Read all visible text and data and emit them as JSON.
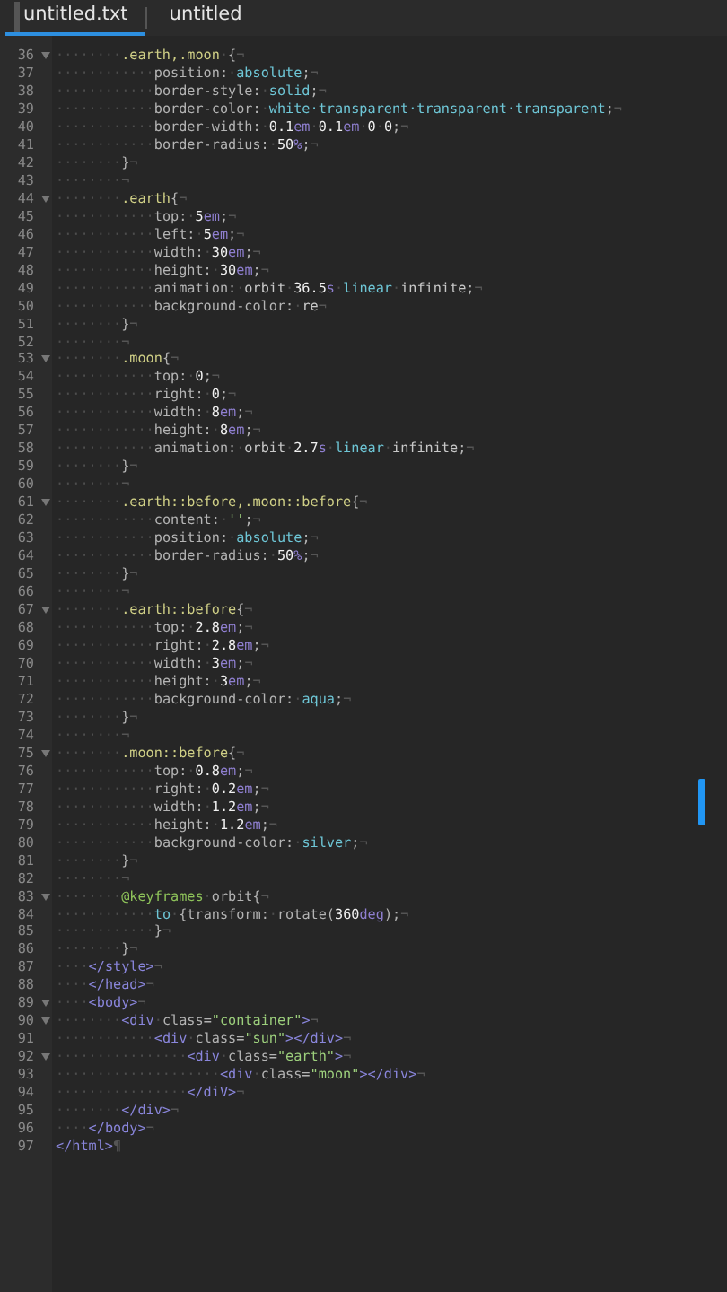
{
  "tabs": [
    {
      "label": "untitled.txt",
      "selected": true
    },
    {
      "label": "untitled",
      "selected": false
    }
  ],
  "lines": [
    {
      "number": "36",
      "foldable": true,
      "tokens": [
        {
          "kind": "ws",
          "text": "········"
        },
        {
          "kind": "selector",
          "text": ".earth,.moon"
        },
        {
          "kind": "ws",
          "text": "·"
        },
        {
          "kind": "punct",
          "text": "{"
        },
        {
          "kind": "eol",
          "text": "¬"
        }
      ]
    },
    {
      "number": "37",
      "foldable": false,
      "tokens": [
        {
          "kind": "ws",
          "text": "············"
        },
        {
          "kind": "prop",
          "text": "position:"
        },
        {
          "kind": "ws",
          "text": "·"
        },
        {
          "kind": "value",
          "text": "absolute"
        },
        {
          "kind": "punct",
          "text": ";"
        },
        {
          "kind": "eol",
          "text": "¬"
        }
      ]
    },
    {
      "number": "38",
      "foldable": false,
      "tokens": [
        {
          "kind": "ws",
          "text": "············"
        },
        {
          "kind": "prop",
          "text": "border-style:"
        },
        {
          "kind": "ws",
          "text": "·"
        },
        {
          "kind": "value",
          "text": "solid"
        },
        {
          "kind": "punct",
          "text": ";"
        },
        {
          "kind": "eol",
          "text": "¬"
        }
      ]
    },
    {
      "number": "39",
      "foldable": false,
      "tokens": [
        {
          "kind": "ws",
          "text": "············"
        },
        {
          "kind": "prop",
          "text": "border-color:"
        },
        {
          "kind": "ws",
          "text": "·"
        },
        {
          "kind": "value",
          "text": "white·transparent·transparent·transparent"
        },
        {
          "kind": "punct",
          "text": ";"
        },
        {
          "kind": "eol",
          "text": "¬"
        }
      ]
    },
    {
      "number": "40",
      "foldable": false,
      "tokens": [
        {
          "kind": "ws",
          "text": "············"
        },
        {
          "kind": "prop",
          "text": "border-width:"
        },
        {
          "kind": "ws",
          "text": "·"
        },
        {
          "kind": "num",
          "text": "0.1"
        },
        {
          "kind": "unit",
          "text": "em"
        },
        {
          "kind": "ws",
          "text": "·"
        },
        {
          "kind": "num",
          "text": "0.1"
        },
        {
          "kind": "unit",
          "text": "em"
        },
        {
          "kind": "ws",
          "text": "·"
        },
        {
          "kind": "num",
          "text": "0"
        },
        {
          "kind": "ws",
          "text": "·"
        },
        {
          "kind": "num",
          "text": "0"
        },
        {
          "kind": "punct",
          "text": ";"
        },
        {
          "kind": "eol",
          "text": "¬"
        }
      ]
    },
    {
      "number": "41",
      "foldable": false,
      "tokens": [
        {
          "kind": "ws",
          "text": "············"
        },
        {
          "kind": "prop",
          "text": "border-radius:"
        },
        {
          "kind": "ws",
          "text": "·"
        },
        {
          "kind": "num",
          "text": "50"
        },
        {
          "kind": "unit",
          "text": "%"
        },
        {
          "kind": "punct",
          "text": ";"
        },
        {
          "kind": "eol",
          "text": "¬"
        }
      ]
    },
    {
      "number": "42",
      "foldable": false,
      "tokens": [
        {
          "kind": "ws",
          "text": "········"
        },
        {
          "kind": "punct",
          "text": "}"
        },
        {
          "kind": "eol",
          "text": "¬"
        }
      ]
    },
    {
      "number": "43",
      "foldable": false,
      "tokens": [
        {
          "kind": "ws",
          "text": "········"
        },
        {
          "kind": "eol",
          "text": "¬"
        }
      ]
    },
    {
      "number": "44",
      "foldable": true,
      "tokens": [
        {
          "kind": "ws",
          "text": "········"
        },
        {
          "kind": "selector",
          "text": ".earth"
        },
        {
          "kind": "punct",
          "text": "{"
        },
        {
          "kind": "eol",
          "text": "¬"
        }
      ]
    },
    {
      "number": "45",
      "foldable": false,
      "tokens": [
        {
          "kind": "ws",
          "text": "············"
        },
        {
          "kind": "prop",
          "text": "top:"
        },
        {
          "kind": "ws",
          "text": "·"
        },
        {
          "kind": "num",
          "text": "5"
        },
        {
          "kind": "unit",
          "text": "em"
        },
        {
          "kind": "punct",
          "text": ";"
        },
        {
          "kind": "eol",
          "text": "¬"
        }
      ]
    },
    {
      "number": "46",
      "foldable": false,
      "tokens": [
        {
          "kind": "ws",
          "text": "············"
        },
        {
          "kind": "prop",
          "text": "left:"
        },
        {
          "kind": "ws",
          "text": "·"
        },
        {
          "kind": "num",
          "text": "5"
        },
        {
          "kind": "unit",
          "text": "em"
        },
        {
          "kind": "punct",
          "text": ";"
        },
        {
          "kind": "eol",
          "text": "¬"
        }
      ]
    },
    {
      "number": "47",
      "foldable": false,
      "tokens": [
        {
          "kind": "ws",
          "text": "············"
        },
        {
          "kind": "prop",
          "text": "width:"
        },
        {
          "kind": "ws",
          "text": "·"
        },
        {
          "kind": "num",
          "text": "30"
        },
        {
          "kind": "unit",
          "text": "em"
        },
        {
          "kind": "punct",
          "text": ";"
        },
        {
          "kind": "eol",
          "text": "¬"
        }
      ]
    },
    {
      "number": "48",
      "foldable": false,
      "tokens": [
        {
          "kind": "ws",
          "text": "············"
        },
        {
          "kind": "prop",
          "text": "height:"
        },
        {
          "kind": "ws",
          "text": "·"
        },
        {
          "kind": "num",
          "text": "30"
        },
        {
          "kind": "unit",
          "text": "em"
        },
        {
          "kind": "punct",
          "text": ";"
        },
        {
          "kind": "eol",
          "text": "¬"
        }
      ]
    },
    {
      "number": "49",
      "foldable": false,
      "tokens": [
        {
          "kind": "ws",
          "text": "············"
        },
        {
          "kind": "prop",
          "text": "animation:"
        },
        {
          "kind": "ws",
          "text": "·"
        },
        {
          "kind": "plain",
          "text": "orbit"
        },
        {
          "kind": "ws",
          "text": "·"
        },
        {
          "kind": "num",
          "text": "36.5"
        },
        {
          "kind": "unit",
          "text": "s"
        },
        {
          "kind": "ws",
          "text": "·"
        },
        {
          "kind": "value",
          "text": "linear"
        },
        {
          "kind": "ws",
          "text": "·"
        },
        {
          "kind": "plain",
          "text": "infinite"
        },
        {
          "kind": "punct",
          "text": ";"
        },
        {
          "kind": "eol",
          "text": "¬"
        }
      ]
    },
    {
      "number": "50",
      "foldable": false,
      "tokens": [
        {
          "kind": "ws",
          "text": "············"
        },
        {
          "kind": "prop",
          "text": "background-color:"
        },
        {
          "kind": "ws",
          "text": "·"
        },
        {
          "kind": "plain",
          "text": "re"
        },
        {
          "kind": "eol",
          "text": "¬"
        }
      ]
    },
    {
      "number": "51",
      "foldable": false,
      "tokens": [
        {
          "kind": "ws",
          "text": "········"
        },
        {
          "kind": "punct",
          "text": "}"
        },
        {
          "kind": "eol",
          "text": "¬"
        }
      ]
    },
    {
      "number": "52",
      "foldable": false,
      "tokens": [
        {
          "kind": "ws",
          "text": "········"
        },
        {
          "kind": "eol",
          "text": "¬"
        }
      ]
    },
    {
      "number": "53",
      "foldable": true,
      "tokens": [
        {
          "kind": "ws",
          "text": "········"
        },
        {
          "kind": "selector",
          "text": ".moon"
        },
        {
          "kind": "punct",
          "text": "{"
        },
        {
          "kind": "eol",
          "text": "¬"
        }
      ]
    },
    {
      "number": "54",
      "foldable": false,
      "tokens": [
        {
          "kind": "ws",
          "text": "············"
        },
        {
          "kind": "prop",
          "text": "top:"
        },
        {
          "kind": "ws",
          "text": "·"
        },
        {
          "kind": "num",
          "text": "0"
        },
        {
          "kind": "punct",
          "text": ";"
        },
        {
          "kind": "eol",
          "text": "¬"
        }
      ]
    },
    {
      "number": "55",
      "foldable": false,
      "tokens": [
        {
          "kind": "ws",
          "text": "············"
        },
        {
          "kind": "prop",
          "text": "right:"
        },
        {
          "kind": "ws",
          "text": "·"
        },
        {
          "kind": "num",
          "text": "0"
        },
        {
          "kind": "punct",
          "text": ";"
        },
        {
          "kind": "eol",
          "text": "¬"
        }
      ]
    },
    {
      "number": "56",
      "foldable": false,
      "tokens": [
        {
          "kind": "ws",
          "text": "············"
        },
        {
          "kind": "prop",
          "text": "width:"
        },
        {
          "kind": "ws",
          "text": "·"
        },
        {
          "kind": "num",
          "text": "8"
        },
        {
          "kind": "unit",
          "text": "em"
        },
        {
          "kind": "punct",
          "text": ";"
        },
        {
          "kind": "eol",
          "text": "¬"
        }
      ]
    },
    {
      "number": "57",
      "foldable": false,
      "tokens": [
        {
          "kind": "ws",
          "text": "············"
        },
        {
          "kind": "prop",
          "text": "height:"
        },
        {
          "kind": "ws",
          "text": "·"
        },
        {
          "kind": "num",
          "text": "8"
        },
        {
          "kind": "unit",
          "text": "em"
        },
        {
          "kind": "punct",
          "text": ";"
        },
        {
          "kind": "eol",
          "text": "¬"
        }
      ]
    },
    {
      "number": "58",
      "foldable": false,
      "tokens": [
        {
          "kind": "ws",
          "text": "············"
        },
        {
          "kind": "prop",
          "text": "animation:"
        },
        {
          "kind": "ws",
          "text": "·"
        },
        {
          "kind": "plain",
          "text": "orbit"
        },
        {
          "kind": "ws",
          "text": "·"
        },
        {
          "kind": "num",
          "text": "2.7"
        },
        {
          "kind": "unit",
          "text": "s"
        },
        {
          "kind": "ws",
          "text": "·"
        },
        {
          "kind": "value",
          "text": "linear"
        },
        {
          "kind": "ws",
          "text": "·"
        },
        {
          "kind": "plain",
          "text": "infinite"
        },
        {
          "kind": "punct",
          "text": ";"
        },
        {
          "kind": "eol",
          "text": "¬"
        }
      ]
    },
    {
      "number": "59",
      "foldable": false,
      "tokens": [
        {
          "kind": "ws",
          "text": "········"
        },
        {
          "kind": "punct",
          "text": "}"
        },
        {
          "kind": "eol",
          "text": "¬"
        }
      ]
    },
    {
      "number": "60",
      "foldable": false,
      "tokens": [
        {
          "kind": "ws",
          "text": "········"
        },
        {
          "kind": "eol",
          "text": "¬"
        }
      ]
    },
    {
      "number": "61",
      "foldable": true,
      "tokens": [
        {
          "kind": "ws",
          "text": "········"
        },
        {
          "kind": "selector",
          "text": ".earth::before,.moon::before"
        },
        {
          "kind": "punct",
          "text": "{"
        },
        {
          "kind": "eol",
          "text": "¬"
        }
      ]
    },
    {
      "number": "62",
      "foldable": false,
      "tokens": [
        {
          "kind": "ws",
          "text": "············"
        },
        {
          "kind": "prop",
          "text": "content:"
        },
        {
          "kind": "ws",
          "text": "·"
        },
        {
          "kind": "string",
          "text": "''"
        },
        {
          "kind": "punct",
          "text": ";"
        },
        {
          "kind": "eol",
          "text": "¬"
        }
      ]
    },
    {
      "number": "63",
      "foldable": false,
      "tokens": [
        {
          "kind": "ws",
          "text": "············"
        },
        {
          "kind": "prop",
          "text": "position:"
        },
        {
          "kind": "ws",
          "text": "·"
        },
        {
          "kind": "value",
          "text": "absolute"
        },
        {
          "kind": "punct",
          "text": ";"
        },
        {
          "kind": "eol",
          "text": "¬"
        }
      ]
    },
    {
      "number": "64",
      "foldable": false,
      "tokens": [
        {
          "kind": "ws",
          "text": "············"
        },
        {
          "kind": "prop",
          "text": "border-radius:"
        },
        {
          "kind": "ws",
          "text": "·"
        },
        {
          "kind": "num",
          "text": "50"
        },
        {
          "kind": "unit",
          "text": "%"
        },
        {
          "kind": "punct",
          "text": ";"
        },
        {
          "kind": "eol",
          "text": "¬"
        }
      ]
    },
    {
      "number": "65",
      "foldable": false,
      "tokens": [
        {
          "kind": "ws",
          "text": "········"
        },
        {
          "kind": "punct",
          "text": "}"
        },
        {
          "kind": "eol",
          "text": "¬"
        }
      ]
    },
    {
      "number": "66",
      "foldable": false,
      "tokens": [
        {
          "kind": "ws",
          "text": "········"
        },
        {
          "kind": "eol",
          "text": "¬"
        }
      ]
    },
    {
      "number": "67",
      "foldable": true,
      "tokens": [
        {
          "kind": "ws",
          "text": "········"
        },
        {
          "kind": "selector",
          "text": ".earth::before"
        },
        {
          "kind": "punct",
          "text": "{"
        },
        {
          "kind": "eol",
          "text": "¬"
        }
      ]
    },
    {
      "number": "68",
      "foldable": false,
      "tokens": [
        {
          "kind": "ws",
          "text": "············"
        },
        {
          "kind": "prop",
          "text": "top:"
        },
        {
          "kind": "ws",
          "text": "·"
        },
        {
          "kind": "num",
          "text": "2.8"
        },
        {
          "kind": "unit",
          "text": "em"
        },
        {
          "kind": "punct",
          "text": ";"
        },
        {
          "kind": "eol",
          "text": "¬"
        }
      ]
    },
    {
      "number": "69",
      "foldable": false,
      "tokens": [
        {
          "kind": "ws",
          "text": "············"
        },
        {
          "kind": "prop",
          "text": "right:"
        },
        {
          "kind": "ws",
          "text": "·"
        },
        {
          "kind": "num",
          "text": "2.8"
        },
        {
          "kind": "unit",
          "text": "em"
        },
        {
          "kind": "punct",
          "text": ";"
        },
        {
          "kind": "eol",
          "text": "¬"
        }
      ]
    },
    {
      "number": "70",
      "foldable": false,
      "tokens": [
        {
          "kind": "ws",
          "text": "············"
        },
        {
          "kind": "prop",
          "text": "width:"
        },
        {
          "kind": "ws",
          "text": "·"
        },
        {
          "kind": "num",
          "text": "3"
        },
        {
          "kind": "unit",
          "text": "em"
        },
        {
          "kind": "punct",
          "text": ";"
        },
        {
          "kind": "eol",
          "text": "¬"
        }
      ]
    },
    {
      "number": "71",
      "foldable": false,
      "tokens": [
        {
          "kind": "ws",
          "text": "············"
        },
        {
          "kind": "prop",
          "text": "height:"
        },
        {
          "kind": "ws",
          "text": "·"
        },
        {
          "kind": "num",
          "text": "3"
        },
        {
          "kind": "unit",
          "text": "em"
        },
        {
          "kind": "punct",
          "text": ";"
        },
        {
          "kind": "eol",
          "text": "¬"
        }
      ]
    },
    {
      "number": "72",
      "foldable": false,
      "tokens": [
        {
          "kind": "ws",
          "text": "············"
        },
        {
          "kind": "prop",
          "text": "background-color:"
        },
        {
          "kind": "ws",
          "text": "·"
        },
        {
          "kind": "value",
          "text": "aqua"
        },
        {
          "kind": "punct",
          "text": ";"
        },
        {
          "kind": "eol",
          "text": "¬"
        }
      ]
    },
    {
      "number": "73",
      "foldable": false,
      "tokens": [
        {
          "kind": "ws",
          "text": "········"
        },
        {
          "kind": "punct",
          "text": "}"
        },
        {
          "kind": "eol",
          "text": "¬"
        }
      ]
    },
    {
      "number": "74",
      "foldable": false,
      "tokens": [
        {
          "kind": "ws",
          "text": "········"
        },
        {
          "kind": "eol",
          "text": "¬"
        }
      ]
    },
    {
      "number": "75",
      "foldable": true,
      "tokens": [
        {
          "kind": "ws",
          "text": "········"
        },
        {
          "kind": "selector",
          "text": ".moon::before"
        },
        {
          "kind": "punct",
          "text": "{"
        },
        {
          "kind": "eol",
          "text": "¬"
        }
      ]
    },
    {
      "number": "76",
      "foldable": false,
      "tokens": [
        {
          "kind": "ws",
          "text": "············"
        },
        {
          "kind": "prop",
          "text": "top:"
        },
        {
          "kind": "ws",
          "text": "·"
        },
        {
          "kind": "num",
          "text": "0.8"
        },
        {
          "kind": "unit",
          "text": "em"
        },
        {
          "kind": "punct",
          "text": ";"
        },
        {
          "kind": "eol",
          "text": "¬"
        }
      ]
    },
    {
      "number": "77",
      "foldable": false,
      "tokens": [
        {
          "kind": "ws",
          "text": "············"
        },
        {
          "kind": "prop",
          "text": "right:"
        },
        {
          "kind": "ws",
          "text": "·"
        },
        {
          "kind": "num",
          "text": "0.2"
        },
        {
          "kind": "unit",
          "text": "em"
        },
        {
          "kind": "punct",
          "text": ";"
        },
        {
          "kind": "eol",
          "text": "¬"
        }
      ]
    },
    {
      "number": "78",
      "foldable": false,
      "tokens": [
        {
          "kind": "ws",
          "text": "············"
        },
        {
          "kind": "prop",
          "text": "width:"
        },
        {
          "kind": "ws",
          "text": "·"
        },
        {
          "kind": "num",
          "text": "1.2"
        },
        {
          "kind": "unit",
          "text": "em"
        },
        {
          "kind": "punct",
          "text": ";"
        },
        {
          "kind": "eol",
          "text": "¬"
        }
      ]
    },
    {
      "number": "79",
      "foldable": false,
      "tokens": [
        {
          "kind": "ws",
          "text": "············"
        },
        {
          "kind": "prop",
          "text": "height:"
        },
        {
          "kind": "ws",
          "text": "·"
        },
        {
          "kind": "num",
          "text": "1.2"
        },
        {
          "kind": "unit",
          "text": "em"
        },
        {
          "kind": "punct",
          "text": ";"
        },
        {
          "kind": "eol",
          "text": "¬"
        }
      ]
    },
    {
      "number": "80",
      "foldable": false,
      "tokens": [
        {
          "kind": "ws",
          "text": "············"
        },
        {
          "kind": "prop",
          "text": "background-color:"
        },
        {
          "kind": "ws",
          "text": "·"
        },
        {
          "kind": "value",
          "text": "silver"
        },
        {
          "kind": "punct",
          "text": ";"
        },
        {
          "kind": "eol",
          "text": "¬"
        }
      ]
    },
    {
      "number": "81",
      "foldable": false,
      "tokens": [
        {
          "kind": "ws",
          "text": "········"
        },
        {
          "kind": "punct",
          "text": "}"
        },
        {
          "kind": "eol",
          "text": "¬"
        }
      ]
    },
    {
      "number": "82",
      "foldable": false,
      "tokens": [
        {
          "kind": "ws",
          "text": "········"
        },
        {
          "kind": "eol",
          "text": "¬"
        }
      ]
    },
    {
      "number": "83",
      "foldable": true,
      "tokens": [
        {
          "kind": "ws",
          "text": "········"
        },
        {
          "kind": "keyword",
          "text": "@keyframes"
        },
        {
          "kind": "ws",
          "text": "·"
        },
        {
          "kind": "prop",
          "text": "orbit"
        },
        {
          "kind": "punct",
          "text": "{"
        },
        {
          "kind": "eol",
          "text": "¬"
        }
      ]
    },
    {
      "number": "84",
      "foldable": false,
      "tokens": [
        {
          "kind": "ws",
          "text": "············"
        },
        {
          "kind": "value",
          "text": "to"
        },
        {
          "kind": "ws",
          "text": "·"
        },
        {
          "kind": "prop",
          "text": "{transform:"
        },
        {
          "kind": "ws",
          "text": "·"
        },
        {
          "kind": "prop",
          "text": "rotate("
        },
        {
          "kind": "num",
          "text": "360"
        },
        {
          "kind": "unit",
          "text": "deg"
        },
        {
          "kind": "punct",
          "text": ");"
        },
        {
          "kind": "eol",
          "text": "¬"
        }
      ]
    },
    {
      "number": "85",
      "foldable": false,
      "tokens": [
        {
          "kind": "ws",
          "text": "············"
        },
        {
          "kind": "punct",
          "text": "}"
        },
        {
          "kind": "eol",
          "text": "¬"
        }
      ]
    },
    {
      "number": "86",
      "foldable": false,
      "tokens": [
        {
          "kind": "ws",
          "text": "········"
        },
        {
          "kind": "punct",
          "text": "}"
        },
        {
          "kind": "eol",
          "text": "¬"
        }
      ]
    },
    {
      "number": "87",
      "foldable": false,
      "tokens": [
        {
          "kind": "ws",
          "text": "····"
        },
        {
          "kind": "tag",
          "text": "</style>"
        },
        {
          "kind": "eol",
          "text": "¬"
        }
      ]
    },
    {
      "number": "88",
      "foldable": false,
      "tokens": [
        {
          "kind": "ws",
          "text": "····"
        },
        {
          "kind": "tag",
          "text": "</head>"
        },
        {
          "kind": "eol",
          "text": "¬"
        }
      ]
    },
    {
      "number": "89",
      "foldable": true,
      "tokens": [
        {
          "kind": "ws",
          "text": "····"
        },
        {
          "kind": "tag",
          "text": "<body>"
        },
        {
          "kind": "eol",
          "text": "¬"
        }
      ]
    },
    {
      "number": "90",
      "foldable": true,
      "tokens": [
        {
          "kind": "ws",
          "text": "········"
        },
        {
          "kind": "tag",
          "text": "<div"
        },
        {
          "kind": "ws",
          "text": "·"
        },
        {
          "kind": "prop",
          "text": "class"
        },
        {
          "kind": "punct",
          "text": "="
        },
        {
          "kind": "string",
          "text": "\"container\""
        },
        {
          "kind": "tag",
          "text": ">"
        },
        {
          "kind": "eol",
          "text": "¬"
        }
      ]
    },
    {
      "number": "91",
      "foldable": false,
      "tokens": [
        {
          "kind": "ws",
          "text": "············"
        },
        {
          "kind": "tag",
          "text": "<div"
        },
        {
          "kind": "ws",
          "text": "·"
        },
        {
          "kind": "prop",
          "text": "class"
        },
        {
          "kind": "punct",
          "text": "="
        },
        {
          "kind": "string",
          "text": "\"sun\""
        },
        {
          "kind": "tag",
          "text": "></div>"
        },
        {
          "kind": "eol",
          "text": "¬"
        }
      ]
    },
    {
      "number": "92",
      "foldable": true,
      "tokens": [
        {
          "kind": "ws",
          "text": "················"
        },
        {
          "kind": "tag",
          "text": "<div"
        },
        {
          "kind": "ws",
          "text": "·"
        },
        {
          "kind": "prop",
          "text": "class"
        },
        {
          "kind": "punct",
          "text": "="
        },
        {
          "kind": "string",
          "text": "\"earth\""
        },
        {
          "kind": "tag",
          "text": ">"
        },
        {
          "kind": "eol",
          "text": "¬"
        }
      ]
    },
    {
      "number": "93",
      "foldable": false,
      "tokens": [
        {
          "kind": "ws",
          "text": "····················"
        },
        {
          "kind": "tag",
          "text": "<div"
        },
        {
          "kind": "ws",
          "text": "·"
        },
        {
          "kind": "prop",
          "text": "class"
        },
        {
          "kind": "punct",
          "text": "="
        },
        {
          "kind": "string",
          "text": "\"moon\""
        },
        {
          "kind": "tag",
          "text": "></div>"
        },
        {
          "kind": "eol",
          "text": "¬"
        }
      ]
    },
    {
      "number": "94",
      "foldable": false,
      "tokens": [
        {
          "kind": "ws",
          "text": "················"
        },
        {
          "kind": "tag",
          "text": "</diV>"
        },
        {
          "kind": "eol",
          "text": "¬"
        }
      ]
    },
    {
      "number": "95",
      "foldable": false,
      "tokens": [
        {
          "kind": "ws",
          "text": "········"
        },
        {
          "kind": "tag",
          "text": "</div>"
        },
        {
          "kind": "eol",
          "text": "¬"
        }
      ]
    },
    {
      "number": "96",
      "foldable": false,
      "tokens": [
        {
          "kind": "ws",
          "text": "····"
        },
        {
          "kind": "tag",
          "text": "</body>"
        },
        {
          "kind": "eol",
          "text": "¬"
        }
      ]
    },
    {
      "number": "97",
      "foldable": false,
      "tokens": [
        {
          "kind": "tag",
          "text": "</html>"
        },
        {
          "kind": "eol",
          "text": "¶"
        }
      ]
    }
  ]
}
